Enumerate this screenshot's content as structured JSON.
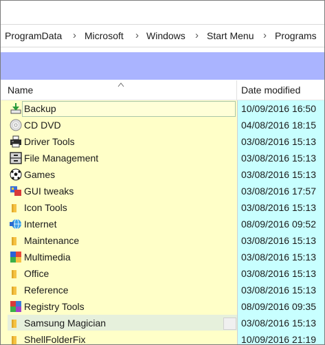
{
  "breadcrumb": [
    "ProgramData",
    "Microsoft",
    "Windows",
    "Start Menu",
    "Programs"
  ],
  "colors": {
    "name_column_bg": "#ffffc8",
    "date_column_bg": "#c8ffff",
    "band": "#aab4ff"
  },
  "columns": {
    "name": "Name",
    "date": "Date modified"
  },
  "rows": [
    {
      "name": "Backup",
      "date": "10/09/2016 16:50",
      "icon": "backup-icon"
    },
    {
      "name": "CD DVD",
      "date": "04/08/2016 18:15",
      "icon": "disc-icon"
    },
    {
      "name": "Driver Tools",
      "date": "03/08/2016 15:13",
      "icon": "printer-icon"
    },
    {
      "name": "File Management",
      "date": "03/08/2016 15:13",
      "icon": "filing-cabinet-icon"
    },
    {
      "name": "Games",
      "date": "03/08/2016 15:13",
      "icon": "soccer-ball-icon"
    },
    {
      "name": "GUI tweaks",
      "date": "03/08/2016 17:57",
      "icon": "gui-tweaks-icon"
    },
    {
      "name": "Icon Tools",
      "date": "03/08/2016 15:13",
      "icon": "folder-icon"
    },
    {
      "name": "Internet",
      "date": "08/09/2016 09:52",
      "icon": "internet-icon"
    },
    {
      "name": "Maintenance",
      "date": "03/08/2016 15:13",
      "icon": "folder-icon"
    },
    {
      "name": "Multimedia",
      "date": "03/08/2016 15:13",
      "icon": "multimedia-icon"
    },
    {
      "name": "Office",
      "date": "03/08/2016 15:13",
      "icon": "folder-icon"
    },
    {
      "name": "Reference",
      "date": "03/08/2016 15:13",
      "icon": "folder-icon"
    },
    {
      "name": "Registry Tools",
      "date": "08/09/2016 09:35",
      "icon": "registry-cube-icon"
    },
    {
      "name": "Samsung Magician",
      "date": "03/08/2016 15:13",
      "icon": "folder-icon"
    },
    {
      "name": "ShellFolderFix",
      "date": "10/09/2016 21:19",
      "icon": "folder-icon"
    }
  ]
}
